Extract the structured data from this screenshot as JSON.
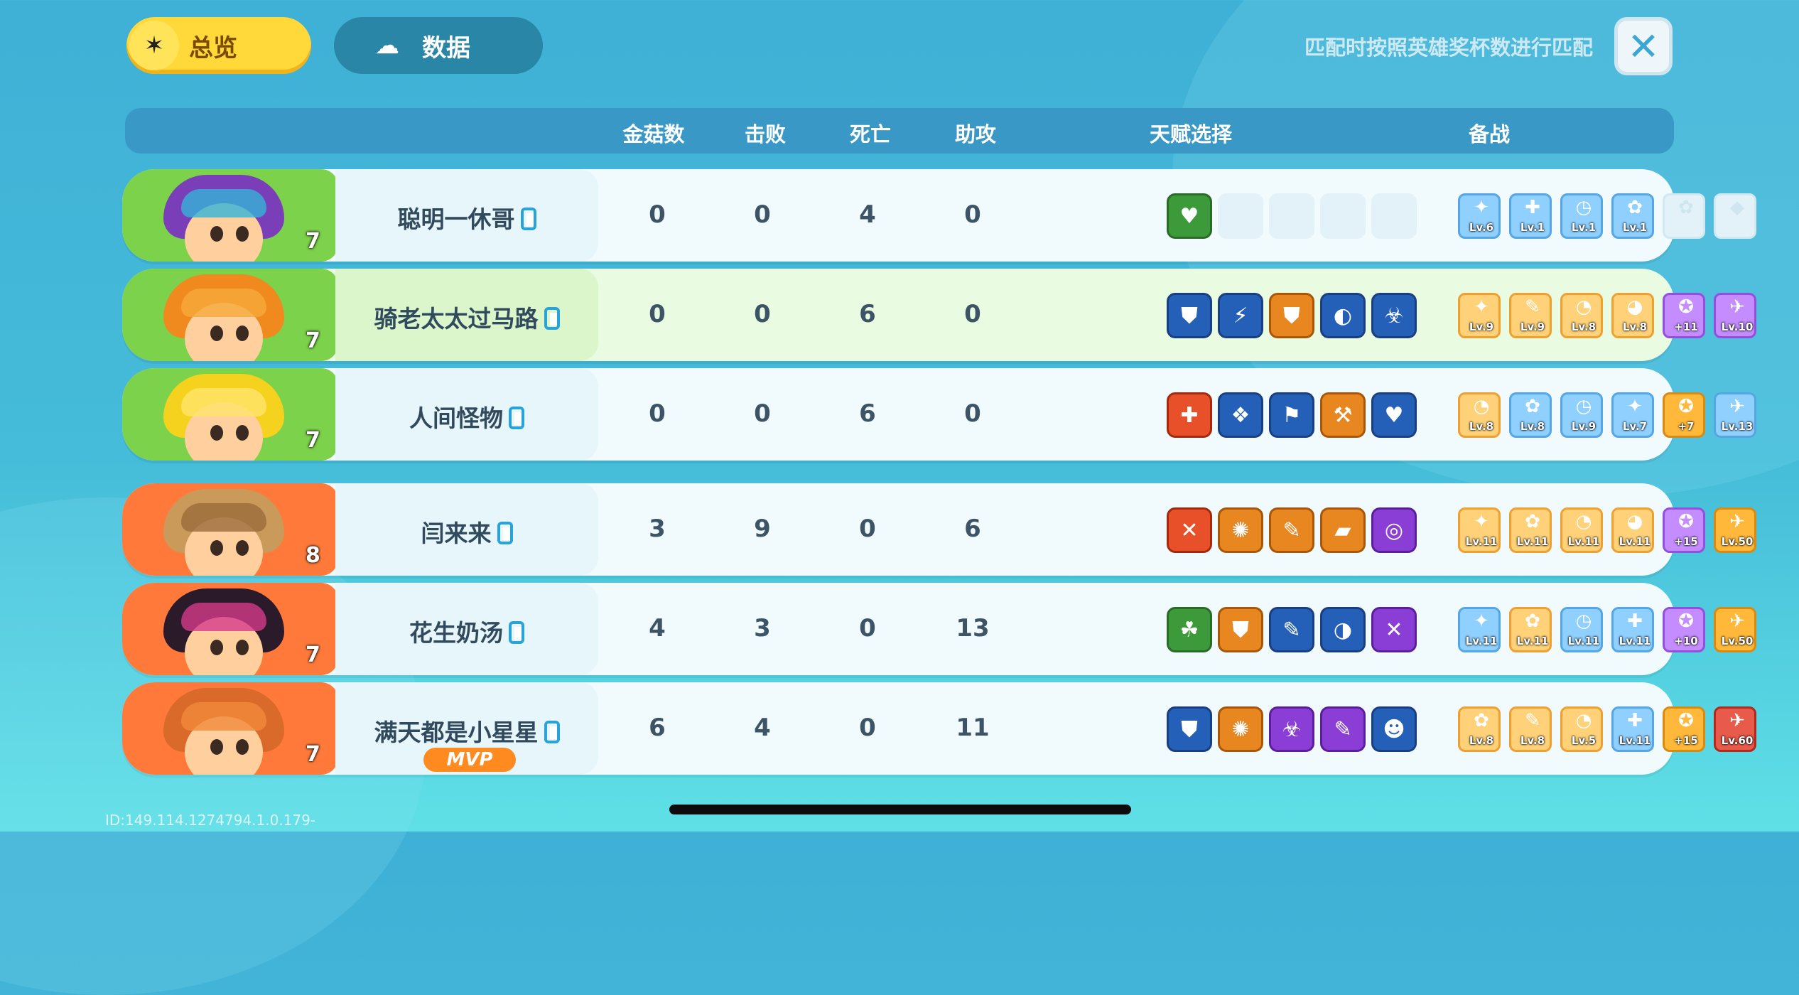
{
  "tabs": {
    "overview": {
      "label": "总览",
      "icon": "hot-pepper-icon"
    },
    "data": {
      "label": "数据",
      "icon": "mushroom-icon"
    }
  },
  "match_hint": "匹配时按照英雄奖杯数进行匹配",
  "close_button": {
    "glyph": "✕"
  },
  "columns": {
    "mushrooms": "金菇数",
    "defeats": "击败",
    "deaths": "死亡",
    "assists": "助攻",
    "talents": "天赋选择",
    "gear": "备战"
  },
  "players": [
    {
      "name": "聪明一休哥",
      "level": "7",
      "team": "green",
      "mushrooms": "0",
      "defeats": "0",
      "deaths": "4",
      "assists": "0",
      "talents": [
        {
          "color": "green",
          "glyph": "♥"
        },
        {
          "color": "empty",
          "glyph": ""
        },
        {
          "color": "empty",
          "glyph": ""
        },
        {
          "color": "empty",
          "glyph": ""
        },
        {
          "color": "empty",
          "glyph": ""
        }
      ],
      "gear": [
        {
          "color": "blue",
          "level": "Lv.6",
          "glyph": "✦"
        },
        {
          "color": "blue",
          "level": "Lv.1",
          "glyph": "✚"
        },
        {
          "color": "blue",
          "level": "Lv.1",
          "glyph": "◷"
        },
        {
          "color": "blue",
          "level": "Lv.1",
          "glyph": "✿"
        },
        {
          "color": "locked",
          "level": "",
          "glyph": "✿"
        },
        {
          "color": "locked",
          "level": "",
          "glyph": "◆"
        }
      ]
    },
    {
      "name": "骑老太太过马路",
      "level": "7",
      "team": "green",
      "mushrooms": "0",
      "defeats": "0",
      "deaths": "6",
      "assists": "0",
      "talents": [
        {
          "color": "blue",
          "glyph": "⛊"
        },
        {
          "color": "blue",
          "glyph": "⚡"
        },
        {
          "color": "orange",
          "glyph": "⛊"
        },
        {
          "color": "blue",
          "glyph": "◐"
        },
        {
          "color": "blue",
          "glyph": "☣"
        }
      ],
      "gear": [
        {
          "color": "orange",
          "level": "Lv.9",
          "glyph": "✦"
        },
        {
          "color": "orange",
          "level": "Lv.9",
          "glyph": "✎"
        },
        {
          "color": "orange",
          "level": "Lv.8",
          "glyph": "◔"
        },
        {
          "color": "orange",
          "level": "Lv.8",
          "glyph": "◕"
        },
        {
          "color": "purple",
          "level": "+11",
          "glyph": "✪"
        },
        {
          "color": "purple",
          "level": "Lv.10",
          "glyph": "✈"
        }
      ]
    },
    {
      "name": "人间怪物",
      "level": "7",
      "team": "green",
      "mushrooms": "0",
      "defeats": "0",
      "deaths": "6",
      "assists": "0",
      "talents": [
        {
          "color": "red",
          "glyph": "✚"
        },
        {
          "color": "blue",
          "glyph": "❖"
        },
        {
          "color": "blue",
          "glyph": "⚑"
        },
        {
          "color": "orange",
          "glyph": "⚒"
        },
        {
          "color": "blue",
          "glyph": "♥"
        }
      ],
      "gear": [
        {
          "color": "orange",
          "level": "Lv.8",
          "glyph": "◔"
        },
        {
          "color": "blue",
          "level": "Lv.8",
          "glyph": "✿"
        },
        {
          "color": "blue",
          "level": "Lv.9",
          "glyph": "◷"
        },
        {
          "color": "blue",
          "level": "Lv.7",
          "glyph": "✦"
        },
        {
          "color": "gold",
          "level": "+7",
          "glyph": "✪"
        },
        {
          "color": "blue",
          "level": "Lv.13",
          "glyph": "✈"
        }
      ]
    },
    {
      "name": "闫来来",
      "level": "8",
      "team": "orange",
      "mushrooms": "3",
      "defeats": "9",
      "deaths": "0",
      "assists": "6",
      "talents": [
        {
          "color": "red",
          "glyph": "✕"
        },
        {
          "color": "orange",
          "glyph": "✺"
        },
        {
          "color": "orange",
          "glyph": "✎"
        },
        {
          "color": "orange",
          "glyph": "▰"
        },
        {
          "color": "purple",
          "glyph": "◎"
        }
      ],
      "gear": [
        {
          "color": "orange",
          "level": "Lv.11",
          "glyph": "✦"
        },
        {
          "color": "orange",
          "level": "Lv.11",
          "glyph": "✿"
        },
        {
          "color": "orange",
          "level": "Lv.11",
          "glyph": "◔"
        },
        {
          "color": "orange",
          "level": "Lv.11",
          "glyph": "◕"
        },
        {
          "color": "purple",
          "level": "+15",
          "glyph": "✪"
        },
        {
          "color": "gold",
          "level": "Lv.50",
          "glyph": "✈"
        }
      ]
    },
    {
      "name": "花生奶汤",
      "level": "7",
      "team": "orange",
      "mushrooms": "4",
      "defeats": "3",
      "deaths": "0",
      "assists": "13",
      "talents": [
        {
          "color": "green",
          "glyph": "☘"
        },
        {
          "color": "orange",
          "glyph": "⛊"
        },
        {
          "color": "blue",
          "glyph": "✎"
        },
        {
          "color": "blue",
          "glyph": "◑"
        },
        {
          "color": "purple",
          "glyph": "✕"
        }
      ],
      "gear": [
        {
          "color": "blue",
          "level": "Lv.11",
          "glyph": "✦"
        },
        {
          "color": "orange",
          "level": "Lv.11",
          "glyph": "✿"
        },
        {
          "color": "blue",
          "level": "Lv.11",
          "glyph": "◷"
        },
        {
          "color": "blue",
          "level": "Lv.11",
          "glyph": "✚"
        },
        {
          "color": "purple",
          "level": "+10",
          "glyph": "✪"
        },
        {
          "color": "gold",
          "level": "Lv.50",
          "glyph": "✈"
        }
      ]
    },
    {
      "name": "满天都是小星星",
      "level": "7",
      "team": "orange",
      "mvp": "MVP",
      "mushrooms": "6",
      "defeats": "4",
      "deaths": "0",
      "assists": "11",
      "talents": [
        {
          "color": "blue",
          "glyph": "⛊"
        },
        {
          "color": "orange",
          "glyph": "✺"
        },
        {
          "color": "purple",
          "glyph": "☣"
        },
        {
          "color": "purple",
          "glyph": "✎"
        },
        {
          "color": "blue",
          "glyph": "☻"
        }
      ],
      "gear": [
        {
          "color": "orange",
          "level": "Lv.8",
          "glyph": "✿"
        },
        {
          "color": "orange",
          "level": "Lv.8",
          "glyph": "✎"
        },
        {
          "color": "orange",
          "level": "Lv.5",
          "glyph": "◔"
        },
        {
          "color": "blue",
          "level": "Lv.11",
          "glyph": "✚"
        },
        {
          "color": "gold",
          "level": "+15",
          "glyph": "✪"
        },
        {
          "color": "red",
          "level": "Lv.60",
          "glyph": "✈"
        }
      ]
    }
  ],
  "build_info": "ID:149.114.1274794.1.0.179-"
}
